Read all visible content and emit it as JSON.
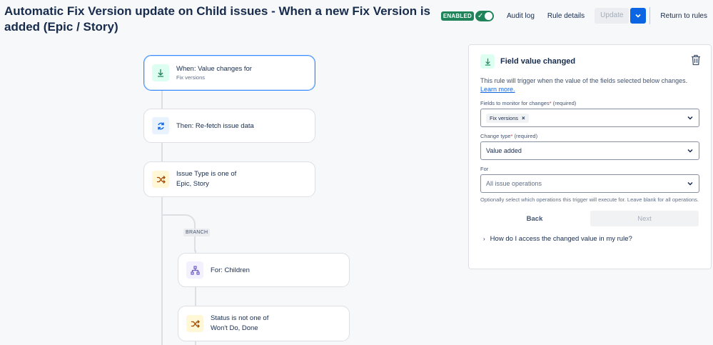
{
  "header": {
    "title": "Automatic Fix Version update on Child issues - When a new Fix Version is added (Epic / Story)",
    "status_badge": "ENABLED",
    "audit_log": "Audit log",
    "rule_details": "Rule details",
    "update": "Update",
    "return_to_rules": "Return to rules"
  },
  "flow": {
    "trigger": {
      "title": "When: Value changes for",
      "subtitle": "Fix versions"
    },
    "action": {
      "title": "Then: Re-fetch issue data"
    },
    "condition": {
      "line1": "Issue Type is one of",
      "line2": "Epic, Story"
    },
    "branch_tag": "BRANCH",
    "branch": {
      "title": "For: Children"
    },
    "branch_condition": {
      "line1": "Status is not one of",
      "line2": "Won't Do, Done"
    }
  },
  "panel": {
    "title": "Field value changed",
    "description": "This rule will trigger when the value of the fields selected below changes.",
    "learn_more": "Learn more.",
    "fields_label": "Fields to monitor for changes",
    "fields_required": "(required)",
    "fields_chip": "Fix versions",
    "change_type_label": "Change type",
    "change_type_required": "(required)",
    "change_type_value": "Value added",
    "for_label": "For",
    "for_placeholder": "All issue operations",
    "helper": "Optionally select which operations this trigger will execute for. Leave blank for all operations.",
    "back": "Back",
    "next": "Next",
    "faq": "How do I access the changed value in my rule?"
  },
  "icons": {
    "trigger": "field-changed-icon",
    "refetch": "refresh-icon",
    "condition": "shuffle-condition-icon",
    "branch": "branch-hierarchy-icon",
    "delete": "trash-icon"
  },
  "colors": {
    "accent": "#0c66e4",
    "enabled": "#1f845a",
    "active_border": "#388bff"
  }
}
